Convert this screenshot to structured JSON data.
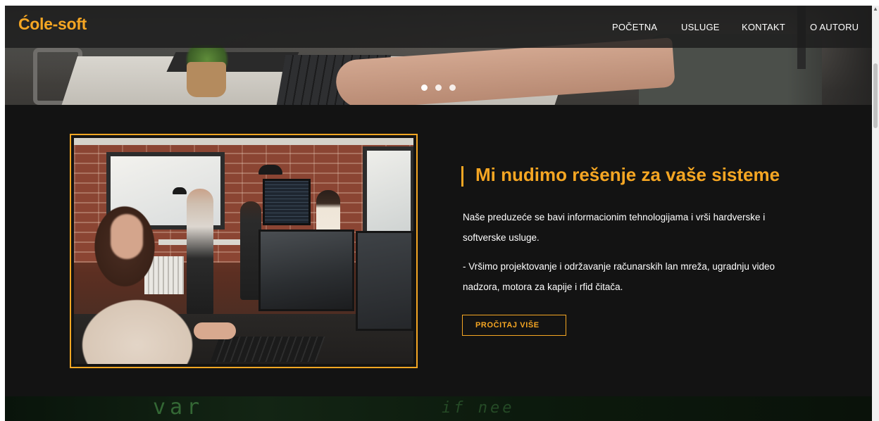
{
  "brand": {
    "logo_text": "Ćole-soft",
    "accent_color": "#f5a623"
  },
  "nav": {
    "items": [
      {
        "label": "POČETNA"
      },
      {
        "label": "USLUGE"
      },
      {
        "label": "KONTAKT"
      },
      {
        "label": "O AUTORU"
      }
    ]
  },
  "slider": {
    "dot_count": 3,
    "active_index": 0
  },
  "feature": {
    "heading": "Mi nudimo rešenje za vaše sisteme",
    "paragraph_1": "Naše preduzeće se bavi informacionim tehnologijama i vrši hardverske i softverske usluge.",
    "paragraph_2": "- Vršimo projektovanje i održavanje računarskih lan mreža, ugradnju video nadzora, motora za kapije i rfid čitača.",
    "button_label": "PROČITAJ VIŠE"
  },
  "next_section": {
    "code_fragment_1": "var",
    "code_fragment_2": "if nee"
  },
  "icons": {
    "scroll_up": "chevron-up-icon"
  }
}
